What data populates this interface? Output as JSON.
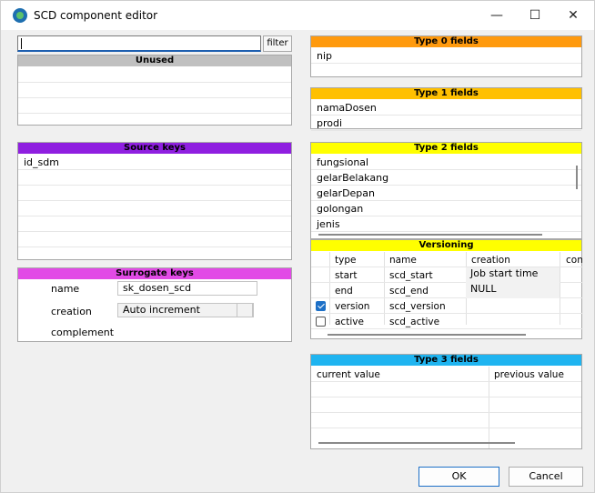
{
  "window": {
    "title": "SCD component editor"
  },
  "controls": {
    "minimize": "—",
    "maximize": "☐",
    "close": "✕"
  },
  "filter": {
    "value": "",
    "button": "filter"
  },
  "unused": {
    "header": "Unused",
    "color": "#c0c0c0"
  },
  "source_keys": {
    "header": "Source keys",
    "color": "#8f1fe0",
    "items": [
      "id_sdm"
    ]
  },
  "surrogate": {
    "header": "Surrogate keys",
    "color": "#e24ae6",
    "name_label": "name",
    "name_value": "sk_dosen_scd",
    "creation_label": "creation",
    "creation_value": "Auto increment",
    "complement_label": "complement"
  },
  "type0": {
    "header": "Type 0 fields",
    "color": "#ff9a0e",
    "items": [
      "nip"
    ]
  },
  "type1": {
    "header": "Type 1 fields",
    "color": "#ffc000",
    "items": [
      "namaDosen",
      "prodi"
    ]
  },
  "type2": {
    "header": "Type 2 fields",
    "color": "#ffff00",
    "items": [
      "fungsional",
      "gelarBelakang",
      "gelarDepan",
      "golongan",
      "jenis"
    ]
  },
  "versioning": {
    "header": "Versioning",
    "color": "#ffff00",
    "columns": [
      "type",
      "name",
      "creation",
      "com"
    ],
    "rows": [
      {
        "type": "start",
        "name": "scd_start",
        "creation": "Job start time",
        "checkbox": null
      },
      {
        "type": "end",
        "name": "scd_end",
        "creation": "NULL",
        "checkbox": null
      },
      {
        "type": "version",
        "name": "scd_version",
        "creation": "",
        "checkbox": true
      },
      {
        "type": "active",
        "name": "scd_active",
        "creation": "",
        "checkbox": false
      }
    ]
  },
  "type3": {
    "header": "Type 3 fields",
    "color": "#1fb4f0",
    "columns": [
      "current value",
      "previous value"
    ]
  },
  "buttons": {
    "ok": "OK",
    "cancel": "Cancel"
  }
}
